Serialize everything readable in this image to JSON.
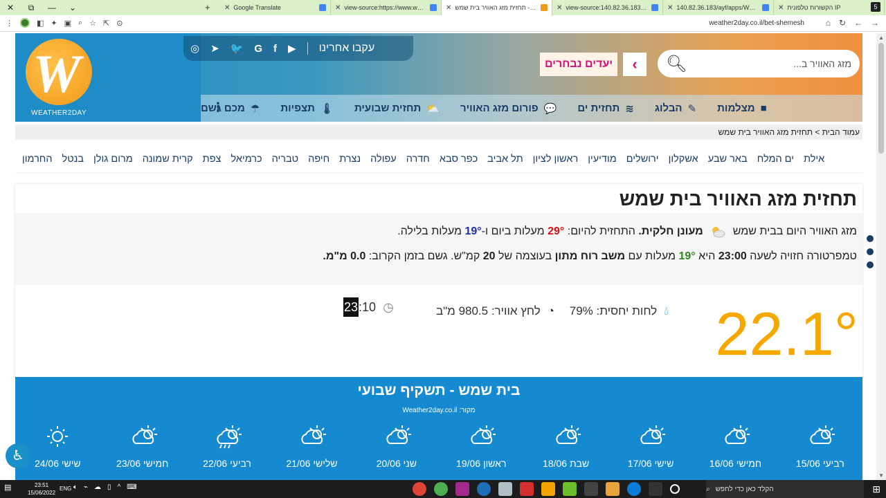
{
  "browser": {
    "tabs": [
      {
        "title": "Google Translate",
        "color": "#4285f4"
      },
      {
        "title": "view-source:https://www.weathe",
        "color": "#4285f4"
      },
      {
        "title": "תחזית מזג האוויר בית שמש - day",
        "color": "#f29a1a"
      },
      {
        "title": "view-source:140.82.36.183/ayf/a",
        "color": "#4285f4"
      },
      {
        "title": "140.82.36.183/ayf/apps/Weathe",
        "color": "#4285f4"
      },
      {
        "title": "הקשורות טלפונית IP",
        "color": "#555555"
      }
    ],
    "url": "weather2day.co.il/bet-shemesh"
  },
  "site": {
    "logo_text": "WEATHER2DAY",
    "follow_label": "עקבו אחרינו",
    "search_placeholder": "מזג האוויר ב...",
    "favorites_label": "יעדים נבחרים",
    "nav": [
      {
        "label": "מכם גשם",
        "icon": "umbrella-icon",
        "glyph": "☂"
      },
      {
        "label": "תצפיות",
        "icon": "thermometer-icon",
        "glyph": "🌡"
      },
      {
        "label": "תחזית שבועית",
        "icon": "sun-cloud-icon",
        "glyph": "⛅"
      },
      {
        "label": "פורום מזג האוויר",
        "icon": "chat-icon",
        "glyph": "💬"
      },
      {
        "label": "תחזית ים",
        "icon": "wave-icon",
        "glyph": "≋"
      },
      {
        "label": "הבלוג",
        "icon": "pencil-icon",
        "glyph": "✎"
      },
      {
        "label": "מצלמות",
        "icon": "video-icon",
        "glyph": "■"
      }
    ],
    "breadcrumb": "עמוד הבית > תחזית מזג האוויר בית שמש",
    "cities": [
      "החרמון",
      "בנטל",
      "מרום גולן",
      "קרית שמונה",
      "צפת",
      "כרמיאל",
      "טבריה",
      "חיפה",
      "נצרת",
      "עפולה",
      "חדרה",
      "כפר סבא",
      "תל אביב",
      "ראשון לציון",
      "מודיעין",
      "ירושלים",
      "אשקלון",
      "באר שבע",
      "ים המלח",
      "אילת"
    ]
  },
  "forecast": {
    "title": "תחזית מזג האוויר בית שמש",
    "line1_a": "מזג האוויר היום בבית שמש",
    "line1_cond": "מעונן חלקית.",
    "line1_b": "התחזית להיום:",
    "max_temp": "29°",
    "line1_c": "מעלות ביום ו-",
    "min_temp": "19°",
    "line1_d": "מעלות בלילה.",
    "line2_a": "טמפרטורה חזויה לשעה",
    "line2_hour": "23:00",
    "line2_b": "היא",
    "line2_temp": "19°",
    "line2_c": "מעלות עם",
    "line2_wind": "משב רוח מתון",
    "line2_d": "בעוצמה של",
    "line2_speed": "20",
    "line2_e": "קמ\"ש. גשם בזמן הקרוב:",
    "line2_rain": "0.0 מ\"מ.",
    "current_temp": "22.1°",
    "humidity": "לחות יחסית: 79%",
    "pressure": "לחץ אוויר: 980.5 מ\"ב",
    "time_h": "23",
    "time_m": ":10"
  },
  "weekly": {
    "title": "בית שמש - תשקיף שבועי",
    "source": "מקור: Weather2day.co.il",
    "days": [
      {
        "label": "רביעי 15/06",
        "icon": "partly-cloudy"
      },
      {
        "label": "חמישי 16/06",
        "icon": "partly-cloudy"
      },
      {
        "label": "שישי 17/06",
        "icon": "partly-cloudy"
      },
      {
        "label": "שבת 18/06",
        "icon": "partly-cloudy"
      },
      {
        "label": "ראשון 19/06",
        "icon": "partly-cloudy"
      },
      {
        "label": "שני 20/06",
        "icon": "partly-cloudy"
      },
      {
        "label": "שלישי 21/06",
        "icon": "partly-cloudy"
      },
      {
        "label": "רביעי 22/06",
        "icon": "rain"
      },
      {
        "label": "חמישי 23/06",
        "icon": "partly-cloudy"
      },
      {
        "label": "שישי 24/06",
        "icon": "sun"
      }
    ]
  },
  "taskbar": {
    "time": "23:51",
    "date": "15/06/2022",
    "lang": "ENG",
    "search_placeholder": "הקלד כאן כדי לחפש"
  },
  "colors": {
    "accent_orange": "#f6a800",
    "brand_blue": "#168ad0",
    "favorite_pink": "#d1127a"
  }
}
